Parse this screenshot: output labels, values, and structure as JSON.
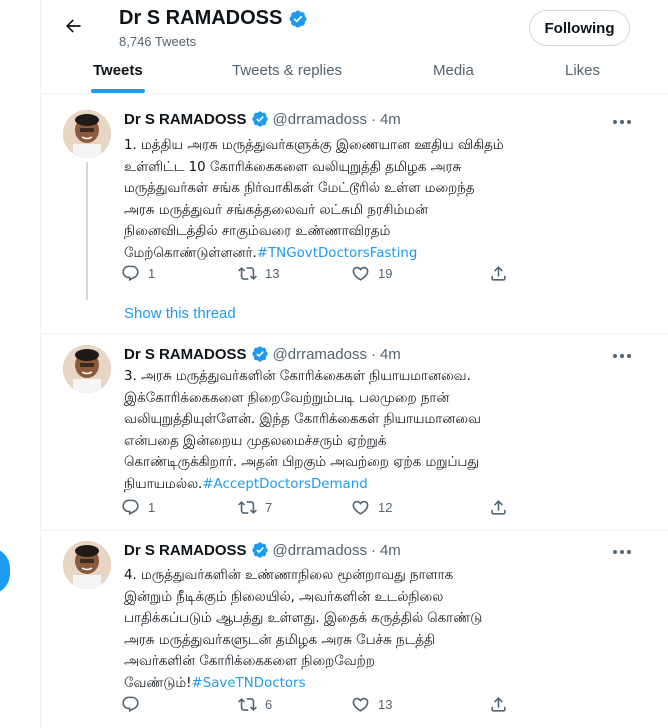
{
  "colors": {
    "accent": "#1d9bf0",
    "text": "#0f1419",
    "muted": "#536471",
    "border": "#eff3f4"
  },
  "header": {
    "back_icon": "arrow-left-icon",
    "name": "Dr S RAMADOSS",
    "verified_icon": "verified-badge-icon",
    "tweet_count": "8,746 Tweets",
    "follow_label": "Following"
  },
  "tabs": [
    {
      "label": "Tweets",
      "active": true
    },
    {
      "label": "Tweets & replies",
      "active": false
    },
    {
      "label": "Media",
      "active": false
    },
    {
      "label": "Likes",
      "active": false
    }
  ],
  "tweets": [
    {
      "name": "Dr S RAMADOSS",
      "handle": "@drramadoss",
      "dot": "·",
      "time": "4m",
      "lines": [
        "1. மத்திய அரசு மருத்துவர்களுக்கு இணையான ஊதிய விகிதம்",
        "உள்ளிட்ட 10 கோரிக்கைகளை  வலியுறுத்தி தமிழக அரசு",
        "மருத்துவர்கள் சங்க நிர்வாகிகள் மேட்டூரில் உள்ள மறைந்த",
        "அரசு மருத்துவர் சங்கத்தலைவர் லட்சுமி நரசிம்மன்",
        "நினைவிடத்தில்  சாகும்வரை உண்ணாவிரதம்"
      ],
      "last_line": "மேற்கொண்டுள்ளனர்.",
      "hashtag": "#TNGovtDoctorsFasting",
      "replies": "1",
      "retweets": "13",
      "likes": "19"
    },
    {
      "name": "Dr S RAMADOSS",
      "handle": "@drramadoss",
      "dot": "·",
      "time": "4m",
      "lines": [
        "3. அரசு மருத்துவர்களின் கோரிக்கைகள் நியாயமானவை.",
        "இக்கோரிக்கைகளை நிறைவேற்றும்படி பலமுறை நான்",
        "வலியுறுத்தியுள்ளேன். இந்த கோரிக்கைகள் நியாயமானவை",
        "என்பதை இன்றைய முதலமைச்சரும் ஏற்றுக்",
        "கொண்டிருக்கிறார். அதன் பிறகும் அவற்றை ஏற்க மறுப்பது"
      ],
      "last_line": "நியாயமல்ல.",
      "hashtag": "#AcceptDoctorsDemand",
      "replies": "1",
      "retweets": "7",
      "likes": "12"
    },
    {
      "name": "Dr S RAMADOSS",
      "handle": "@drramadoss",
      "dot": "·",
      "time": "4m",
      "lines": [
        "4. மருத்துவர்களின் உண்ணாநிலை மூன்றாவது நாளாக",
        "இன்றும் நீடிக்கும் நிலையில், அவர்களின் உடல்நிலை",
        "பாதிக்கப்படும் ஆபத்து உள்ளது.  இதைக் கருத்தில் கொண்டு",
        "அரசு மருத்துவர்களுடன் தமிழக அரசு பேச்சு நடத்தி",
        "அவர்களின் கோரிக்கைகளை நிறைவேற்ற"
      ],
      "last_line": "வேண்டும்!",
      "hashtag": "#SaveTNDoctors",
      "replies": "",
      "retweets": "6",
      "likes": "13"
    }
  ],
  "show_thread": "Show this thread",
  "icons": {
    "reply": "reply-icon",
    "retweet": "retweet-icon",
    "like": "heart-icon",
    "share": "share-icon",
    "more": "more-icon"
  }
}
